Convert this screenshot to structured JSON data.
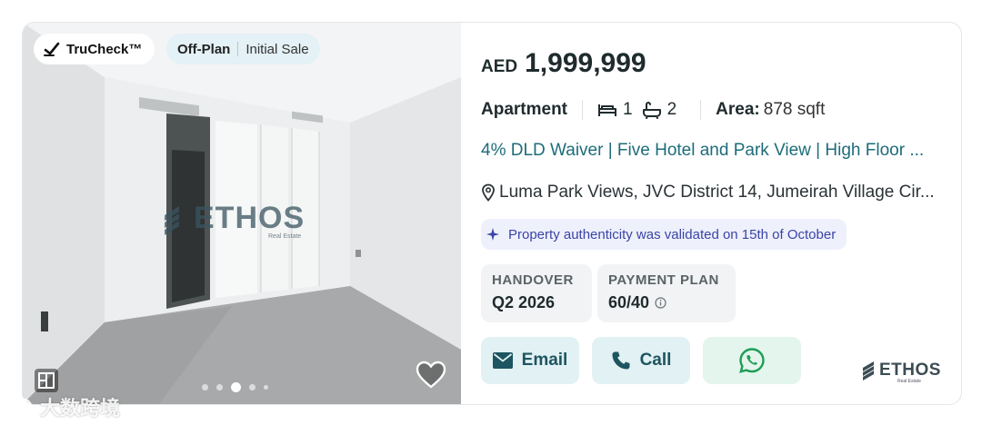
{
  "badges": {
    "trucheck": "TruCheck™",
    "listing_type": "Off-Plan",
    "sale_type": "Initial Sale"
  },
  "photo": {
    "watermark_word": "ETHOS",
    "watermark_sub": "Real Estate",
    "carousel_dots": 5,
    "active_dot": 3
  },
  "listing": {
    "currency": "AED",
    "price": "1,999,999",
    "property_type": "Apartment",
    "bedrooms": "1",
    "bathrooms": "2",
    "area_label": "Area:",
    "area_value": "878 sqft",
    "title": "4% DLD Waiver | Five Hotel and Park View | High Floor ...",
    "location": "Luma Park Views, JVC District 14, Jumeirah Village Cir..."
  },
  "validation": {
    "text": "Property authenticity was validated on 15th of October"
  },
  "details": {
    "handover_label": "HANDOVER",
    "handover_value": "Q2 2026",
    "payment_label": "PAYMENT PLAN",
    "payment_value": "60/40"
  },
  "actions": {
    "email_label": "Email",
    "call_label": "Call"
  },
  "agency": {
    "name": "ETHOS",
    "sub": "Real Estate"
  },
  "overlay_watermark": "大数跨境",
  "colors": {
    "link": "#1d6c7a",
    "button_bg": "#e2f1f3",
    "whatsapp_bg": "#e3f5ec",
    "whatsapp_icon": "#1f9d55",
    "validated_bg": "#eef0fc",
    "validated_text": "#3a45a5"
  }
}
